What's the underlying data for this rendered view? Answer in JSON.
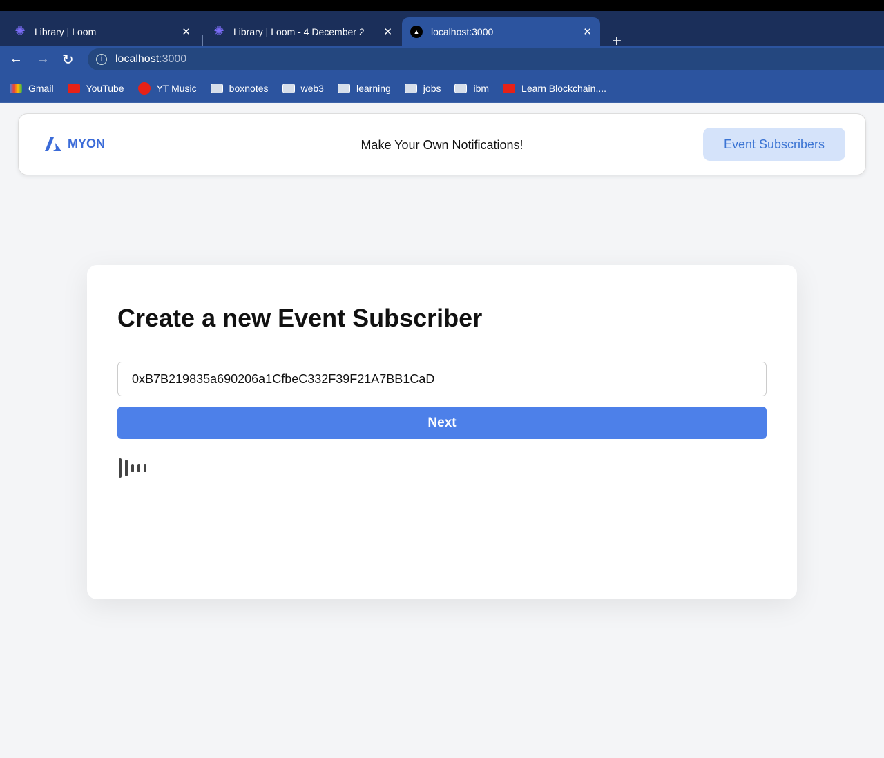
{
  "browser": {
    "tabs": [
      {
        "title": "Library | Loom"
      },
      {
        "title": "Library | Loom - 4 December 2"
      },
      {
        "title": "localhost:3000",
        "active": true
      }
    ],
    "url_host": "localhost",
    "url_port": ":3000",
    "bookmarks": [
      {
        "label": "Gmail",
        "icon": "gmail-icon"
      },
      {
        "label": "YouTube",
        "icon": "youtube-icon"
      },
      {
        "label": "YT Music",
        "icon": "yt-music-icon"
      },
      {
        "label": "boxnotes",
        "icon": "folder-icon"
      },
      {
        "label": "web3",
        "icon": "folder-icon"
      },
      {
        "label": "learning",
        "icon": "folder-icon"
      },
      {
        "label": "jobs",
        "icon": "folder-icon"
      },
      {
        "label": "ibm",
        "icon": "folder-icon"
      },
      {
        "label": "Learn Blockchain,...",
        "icon": "youtube-icon"
      }
    ]
  },
  "header": {
    "logo": "MYON",
    "tagline": "Make Your Own Notifications!",
    "subscribers_button": "Event Subscribers"
  },
  "card": {
    "title": "Create a new Event Subscriber",
    "address_value": "0xB7B219835a690206a1CfbeC332F39F21A7BB1CaD",
    "next_label": "Next"
  },
  "colors": {
    "accent": "#4d80e9",
    "brand": "#3b6bd8"
  }
}
